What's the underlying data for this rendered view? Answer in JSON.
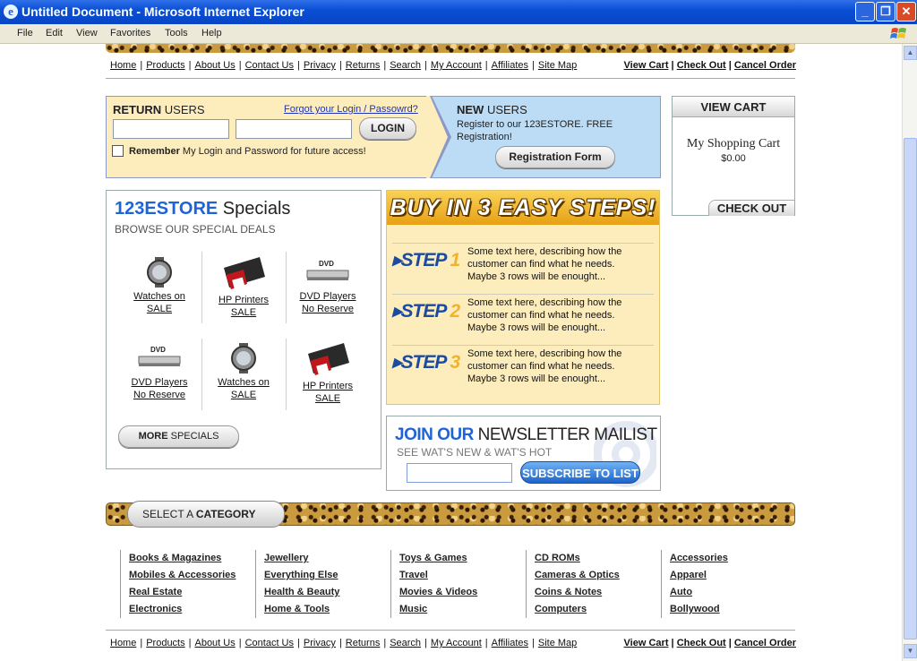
{
  "window": {
    "title": "Untitled Document - Microsoft Internet Explorer"
  },
  "menu": [
    "File",
    "Edit",
    "View",
    "Favorites",
    "Tools",
    "Help"
  ],
  "nav": {
    "links": [
      "Home",
      "Products",
      "About Us",
      "Contact Us",
      "Privacy",
      "Returns",
      "Search",
      "My Account",
      "Affiliates",
      "Site Map"
    ],
    "cart_links": [
      "View Cart",
      "Check Out",
      "Cancel Order"
    ]
  },
  "login": {
    "heading_bold": "RETURN",
    "heading_rest": " USERS",
    "forgot": "Forgot your Login / Passowrd?",
    "button": "LOGIN",
    "remember_bold": "Remember",
    "remember_rest": " My Login and Password for future access!"
  },
  "new_users": {
    "heading_bold": "NEW",
    "heading_rest": " USERS",
    "text": "Register to our 123ESTORE. FREE Registration!",
    "button": "Registration Form"
  },
  "cart": {
    "title": "VIEW CART",
    "heading": "My Shopping Cart",
    "amount": "$0.00",
    "checkout": "CHECK OUT"
  },
  "specials": {
    "brand": "123ESTORE",
    "title": " Specials",
    "subtitle": "BROWSE OUR SPECIAL DEALS",
    "items": [
      {
        "line1": "Watches on",
        "line2": "SALE",
        "icon": "watch-icon"
      },
      {
        "line1": "HP Printers",
        "line2": "SALE",
        "icon": "printer-icon"
      },
      {
        "line1": "DVD Players",
        "line2": "No Reserve",
        "icon": "dvd-player-icon"
      },
      {
        "line1": "DVD Players",
        "line2": "No Reserve",
        "icon": "dvd-player-icon"
      },
      {
        "line1": "Watches on",
        "line2": "SALE",
        "icon": "watch-icon"
      },
      {
        "line1": "HP Printers",
        "line2": "SALE",
        "icon": "printer-icon"
      }
    ],
    "more_bold": "MORE",
    "more_rest": " SPECIALS"
  },
  "steps": {
    "banner": "BUY IN 3 EASY STEPS!",
    "label": "STEP",
    "items": [
      {
        "num": "1",
        "text": "Some text here, describing how the customer can find what he needs. Maybe 3 rows will be enought..."
      },
      {
        "num": "2",
        "text": "Some text here, describing how the customer can find what he needs. Maybe 3 rows will be enought..."
      },
      {
        "num": "3",
        "text": "Some text here, describing how the customer can find what he needs. Maybe 3 rows will be enought..."
      }
    ]
  },
  "newsletter": {
    "title_blue": "JOIN OUR",
    "title_rest": " NEWSLETTER MAILIST",
    "subtitle": "SEE WAT'S NEW & WAT'S HOT",
    "button": "SUBSCRIBE TO LIST"
  },
  "category": {
    "label_plain": "SELECT A ",
    "label_bold": "CATEGORY",
    "columns": [
      [
        "Books & Magazines",
        "Mobiles & Accessories",
        "Real Estate",
        "Electronics"
      ],
      [
        "Jewellery",
        "Everything Else",
        "Health & Beauty",
        "Home & Tools"
      ],
      [
        "Toys & Games",
        "Travel",
        "Movies & Videos",
        "Music"
      ],
      [
        "CD ROMs",
        "Cameras & Optics",
        "Coins & Notes",
        "Computers"
      ],
      [
        "Accessories",
        "Apparel",
        "Auto",
        "Bollywood"
      ]
    ]
  },
  "colors": {
    "accent_blue": "#1f63d8",
    "login_bg": "#fdecbc",
    "new_users_bg": "#bcdcf6"
  }
}
